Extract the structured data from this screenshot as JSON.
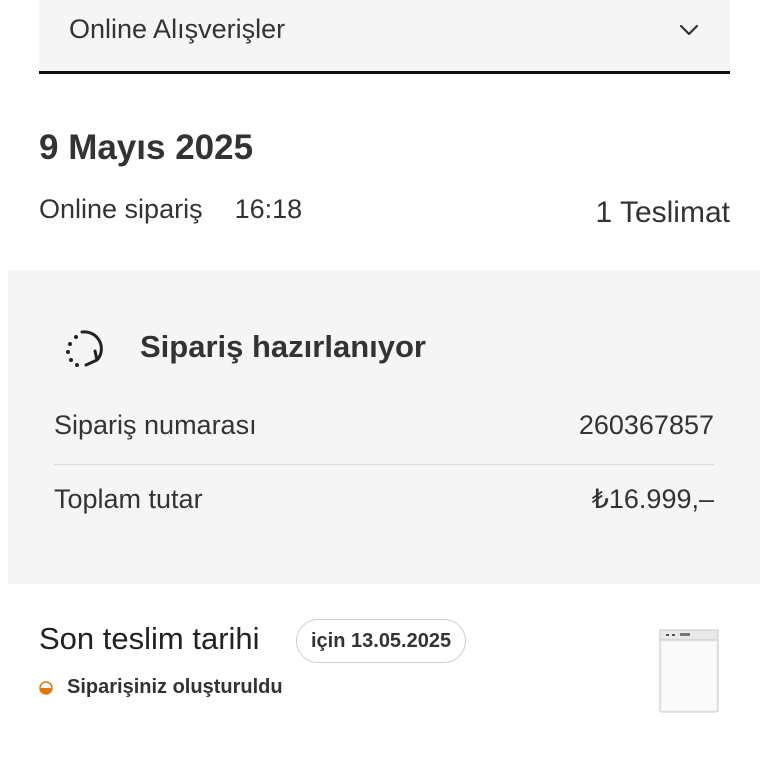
{
  "dropdown": {
    "label": "Online Alışverişler",
    "icon": "chevron-down-icon"
  },
  "order": {
    "date": "9 Mayıs 2025",
    "channel": "Online sipariş",
    "time": "16:18",
    "deliveries": "1 Teslimat"
  },
  "status": {
    "title": "Sipariş hazırlanıyor",
    "icon": "loading-circle-arrow-icon",
    "rows": [
      {
        "label": "Sipariş numarası",
        "value": "260367857"
      },
      {
        "label": "Toplam tutar",
        "value": "₺16.999,–"
      }
    ]
  },
  "delivery": {
    "title": "Son teslim tarihi",
    "date_pill": "için 13.05.2025",
    "progress_text": "Siparişiniz oluşturuldu",
    "progress_color": "#e07a10",
    "product_icon": "dishwasher-thumbnail"
  }
}
